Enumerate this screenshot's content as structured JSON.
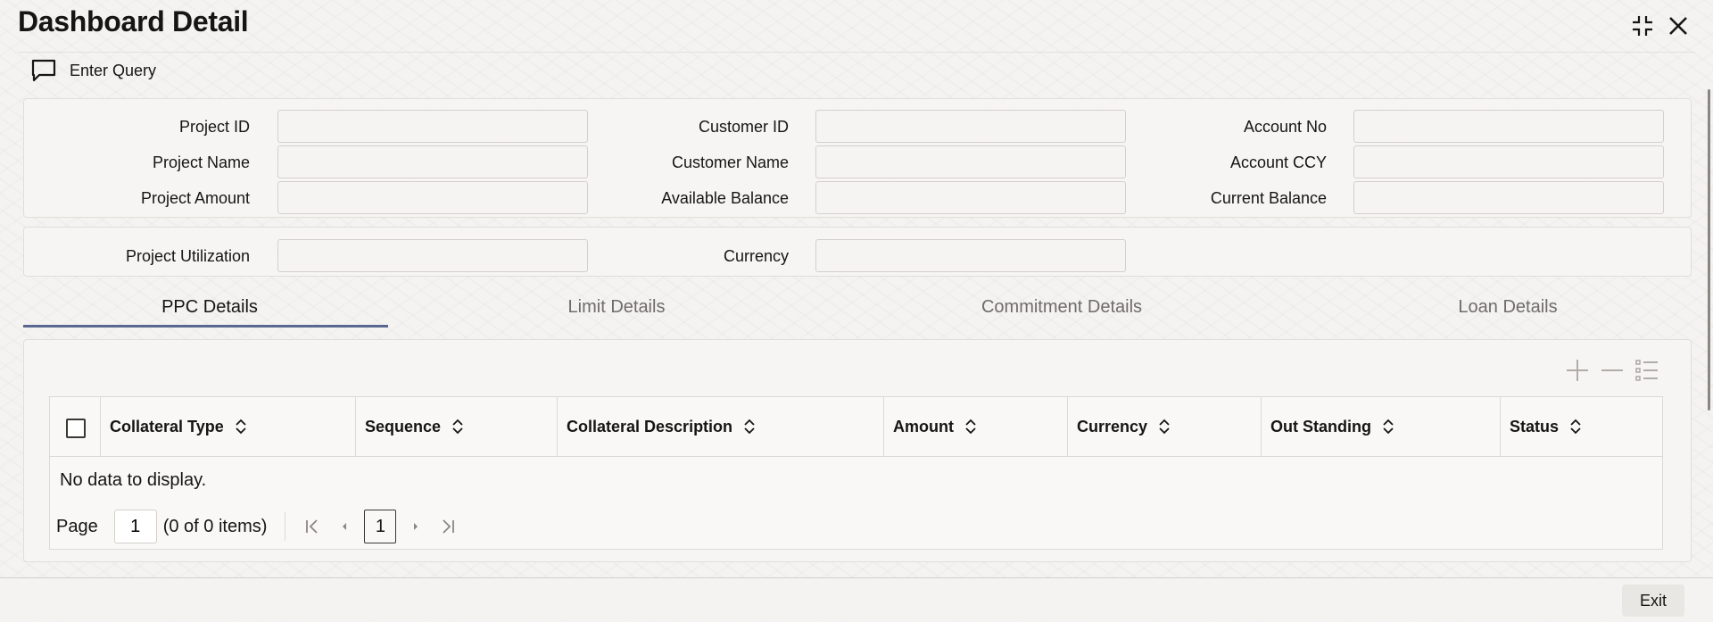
{
  "window": {
    "title": "Dashboard Detail"
  },
  "toolbar": {
    "enter_query_label": "Enter Query"
  },
  "fields": {
    "project_id": {
      "label": "Project ID",
      "value": ""
    },
    "project_name": {
      "label": "Project Name",
      "value": ""
    },
    "project_amount": {
      "label": "Project Amount",
      "value": ""
    },
    "customer_id": {
      "label": "Customer ID",
      "value": ""
    },
    "customer_name": {
      "label": "Customer Name",
      "value": ""
    },
    "available_balance": {
      "label": "Available Balance",
      "value": ""
    },
    "account_no": {
      "label": "Account No",
      "value": ""
    },
    "account_ccy": {
      "label": "Account CCY",
      "value": ""
    },
    "current_balance": {
      "label": "Current Balance",
      "value": ""
    },
    "project_utilization": {
      "label": "Project Utilization",
      "value": ""
    },
    "currency": {
      "label": "Currency",
      "value": ""
    }
  },
  "tabs": [
    {
      "label": "PPC Details",
      "active": true
    },
    {
      "label": "Limit Details",
      "active": false
    },
    {
      "label": "Commitment Details",
      "active": false
    },
    {
      "label": "Loan Details",
      "active": false
    }
  ],
  "grid": {
    "columns": [
      "Collateral Type",
      "Sequence",
      "Collateral Description",
      "Amount",
      "Currency",
      "Out Standing",
      "Status"
    ],
    "rows": [],
    "empty_text": "No data to display.",
    "pager": {
      "page_label": "Page",
      "page_value": "1",
      "items_info": "(0 of 0 items)",
      "current_page": "1"
    }
  },
  "footer": {
    "exit_label": "Exit"
  },
  "colors": {
    "accent_underline": "#5a6791",
    "background": "#f4f3f1"
  }
}
